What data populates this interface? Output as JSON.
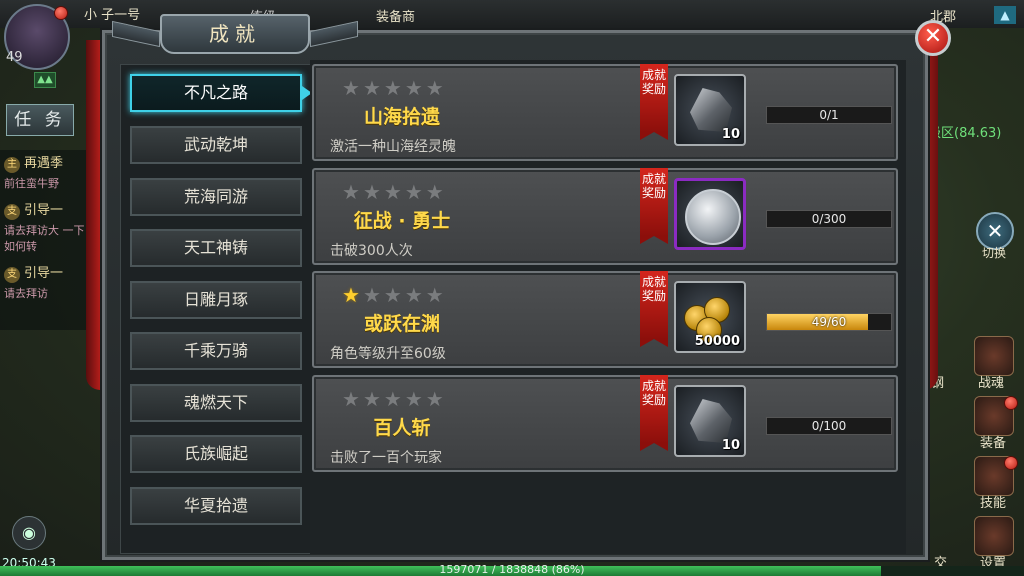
{
  "player": {
    "level": "49",
    "name_partial": "小 子一号"
  },
  "top_bar": {
    "tab_partial": "练级",
    "shop": "装备商",
    "zone_partial": "北郡"
  },
  "tasks": {
    "tab_label": "任 务",
    "items": [
      {
        "badge": "主",
        "title": "再遇季",
        "sub": "前往蛮牛野"
      },
      {
        "badge": "支",
        "title": "引导一",
        "sub": "请去拜访大 一下如何转"
      },
      {
        "badge": "支",
        "title": "引导一",
        "sub": "请去拜访"
      }
    ]
  },
  "zone_level_text": "级区(84.63)",
  "switch_label": "切换",
  "side_buttons": {
    "forge": "锻钢",
    "soul": "战魂",
    "equip": "装备",
    "skill": "技能",
    "social": "交",
    "settings": "设置"
  },
  "clock": "20:50:43",
  "exp": {
    "text": "1597071 / 1838848 (86%)",
    "fraction": 0.86
  },
  "panel": {
    "title": "成就",
    "close_icon": "close-icon",
    "categories": [
      "不凡之路",
      "武动乾坤",
      "荒海同游",
      "天工神铸",
      "日雕月琢",
      "千乘万骑",
      "魂燃天下",
      "氏族崛起",
      "华夏拾遗"
    ],
    "active_category": 0,
    "reward_label": "成就奖励",
    "achievements": [
      {
        "name": "山海拾遗",
        "desc": "激活一种山海经灵魄",
        "stars_lit": 0,
        "reward_icon": "ore-icon",
        "reward_qty": "10",
        "progress_text": "0/1",
        "progress": 0.0
      },
      {
        "name": "征战 · 勇士",
        "desc": "击破300人次",
        "stars_lit": 0,
        "reward_icon": "silver-coin-icon",
        "reward_qty": "",
        "progress_text": "0/300",
        "progress": 0.0
      },
      {
        "name": "或跃在渊",
        "desc": "角色等级升至60级",
        "stars_lit": 1,
        "reward_icon": "gold-coins-icon",
        "reward_qty": "50000",
        "progress_text": "49/60",
        "progress": 0.8167
      },
      {
        "name": "百人斩",
        "desc": "击败了一百个玩家",
        "stars_lit": 0,
        "reward_icon": "ore-icon",
        "reward_qty": "10",
        "progress_text": "0/100",
        "progress": 0.0
      }
    ]
  }
}
